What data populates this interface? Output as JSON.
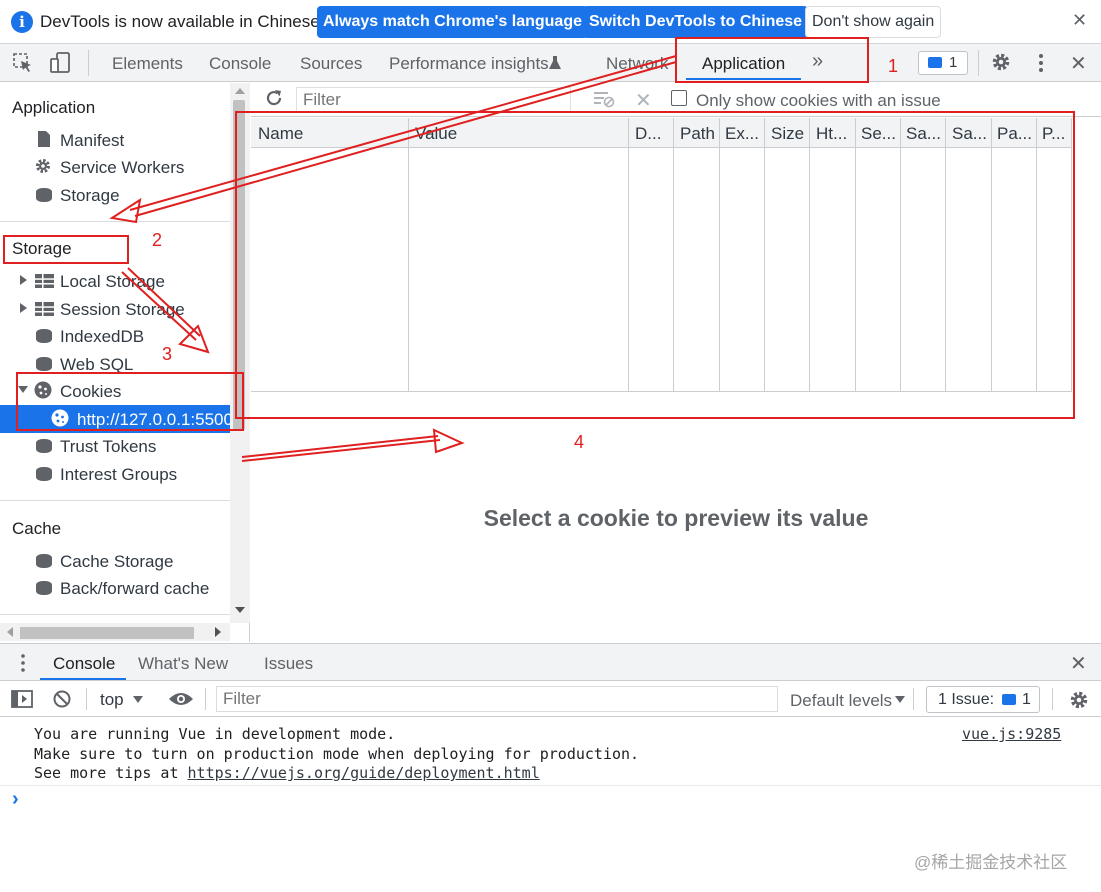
{
  "infobar": {
    "icon": "info-icon",
    "message": "DevTools is now available in Chinese!",
    "button_match": "Always match Chrome's language",
    "button_switch": "Switch DevTools to Chinese",
    "button_dismiss": "Don't show again",
    "close_glyph": "✕"
  },
  "toolbar": {
    "tabs": [
      "Elements",
      "Console",
      "Sources",
      "Performance insights",
      "Network",
      "Application"
    ],
    "active_tab": "Application",
    "more_glyph": "»",
    "issues_count": "1",
    "close_glyph": "✕"
  },
  "sidebar": {
    "application": {
      "title": "Application",
      "items": [
        {
          "label": "Manifest",
          "icon": "document-icon"
        },
        {
          "label": "Service Workers",
          "icon": "gear-icon"
        },
        {
          "label": "Storage",
          "icon": "database-icon"
        }
      ]
    },
    "storage": {
      "title": "Storage",
      "items": [
        {
          "label": "Local Storage",
          "icon": "table-icon",
          "expandable": true
        },
        {
          "label": "Session Storage",
          "icon": "table-icon",
          "expandable": true
        },
        {
          "label": "IndexedDB",
          "icon": "database-icon"
        },
        {
          "label": "Web SQL",
          "icon": "database-icon"
        },
        {
          "label": "Cookies",
          "icon": "cookie-icon",
          "expanded": true
        },
        {
          "label": "http://127.0.0.1:5500",
          "icon": "cookie-icon",
          "selected": true
        },
        {
          "label": "Trust Tokens",
          "icon": "database-icon"
        },
        {
          "label": "Interest Groups",
          "icon": "database-icon"
        }
      ]
    },
    "cache": {
      "title": "Cache",
      "items": [
        {
          "label": "Cache Storage",
          "icon": "database-icon"
        },
        {
          "label": "Back/forward cache",
          "icon": "database-icon"
        }
      ]
    }
  },
  "cookies": {
    "filter_placeholder": "Filter",
    "only_issues_label": "Only show cookies with an issue",
    "columns": [
      "Name",
      "Value",
      "D...",
      "Path",
      "Ex...",
      "Size",
      "Ht...",
      "Se...",
      "Sa...",
      "Sa...",
      "Pa...",
      "P..."
    ],
    "empty_message": "Select a cookie to preview its value"
  },
  "drawer": {
    "tabs": [
      "Console",
      "What's New",
      "Issues"
    ],
    "active_tab": "Console",
    "context": "top",
    "filter_placeholder": "Filter",
    "levels": "Default levels",
    "issues_label": "1 Issue:",
    "issues_count": "1",
    "messages": {
      "line1": "You are running Vue in development mode.",
      "line2": "Make sure to turn on production mode when deploying for production.",
      "line3_prefix": "See more tips at ",
      "line3_link": "https://vuejs.org/guide/deployment.html",
      "source": "vue.js:9285"
    },
    "prompt_glyph": "›"
  },
  "annotations": [
    "1",
    "2",
    "3",
    "4"
  ],
  "watermark": "@稀土掘金技术社区",
  "colors": {
    "accent": "#1a73e8",
    "annotation": "#e02020",
    "toolbar_bg": "#f1f3f4"
  }
}
